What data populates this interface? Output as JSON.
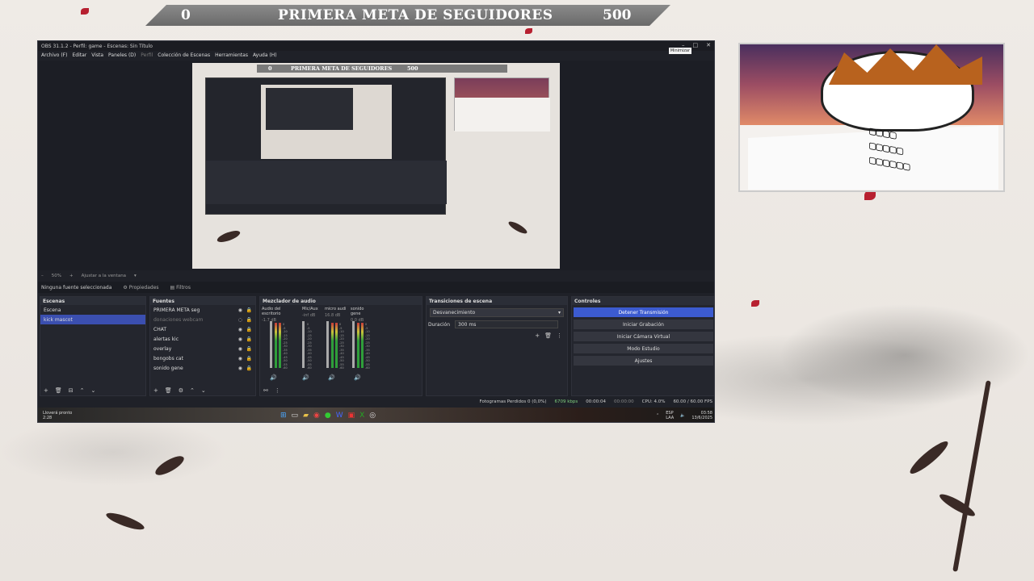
{
  "overlay_bar": {
    "current": "0",
    "title": "PRIMERA META DE SEGUIDORES",
    "goal": "500"
  },
  "obs": {
    "title": "OBS 31.1.2 - Perfil: game - Escenas: Sin Título",
    "tooltip": "Minimizar",
    "menu": [
      "Archivo (F)",
      "Editar",
      "Vista",
      "Paneles (D)",
      "Perfil",
      "Colección de Escenas",
      "Herramientas",
      "Ayuda (H)"
    ],
    "zoom": "50%",
    "fit": "Ajustar a la ventana",
    "no_source": "Ninguna fuente seleccionada",
    "properties": "Propiedades",
    "filters": "Filtros",
    "scenes": {
      "header": "Escenas",
      "items": [
        "Escena",
        "kick mascot"
      ]
    },
    "sources": {
      "header": "Fuentes",
      "items": [
        "PRIMERA META seg",
        "donaciones webcam",
        "CHAT",
        "alertas kic",
        "overlay",
        "bongobs cat",
        "sonido gene"
      ]
    },
    "mixer": {
      "header": "Mezclador de audio",
      "channels": [
        {
          "name": "Audio del escritorio",
          "db": "-1.7 dB"
        },
        {
          "name": "Mic/Aux",
          "db": "-inf dB"
        },
        {
          "name": "micro audi",
          "db": "16.8 dB"
        },
        {
          "name": "sonido gene",
          "db": "0.0 dB"
        }
      ],
      "scale": [
        "0",
        "-5",
        "-10",
        "-15",
        "-20",
        "-25",
        "-30",
        "-35",
        "-40",
        "-45",
        "-50",
        "-55",
        "-60"
      ]
    },
    "transitions": {
      "header": "Transiciones de escena",
      "selected": "Desvanecimiento",
      "duration_label": "Duración",
      "duration": "300 ms"
    },
    "controls": {
      "header": "Controles",
      "buttons": [
        "Detener Transmisión",
        "Iniciar Grabación",
        "Iniciar Cámara Virtual",
        "Modo Estudio",
        "Ajustes"
      ]
    },
    "status": {
      "dropped": "Fotogramas Perdidos 0 (0,0%)",
      "bitrate": "6709 kbps",
      "live": "00:00:04",
      "rec": "00:00:00",
      "cpu": "CPU: 4.0%",
      "fps": "60.00 / 60.00 FPS"
    }
  },
  "taskbar": {
    "weather": "Lloverá pronto",
    "weather_sub": "2:28",
    "lang": "ESP",
    "lang_sub": "LAA",
    "time": "03:58",
    "date": "13/6/2025"
  },
  "colors": {
    "accent": "#3c5bd0",
    "selection": "#3b4fb0",
    "petal": "#b72030"
  }
}
